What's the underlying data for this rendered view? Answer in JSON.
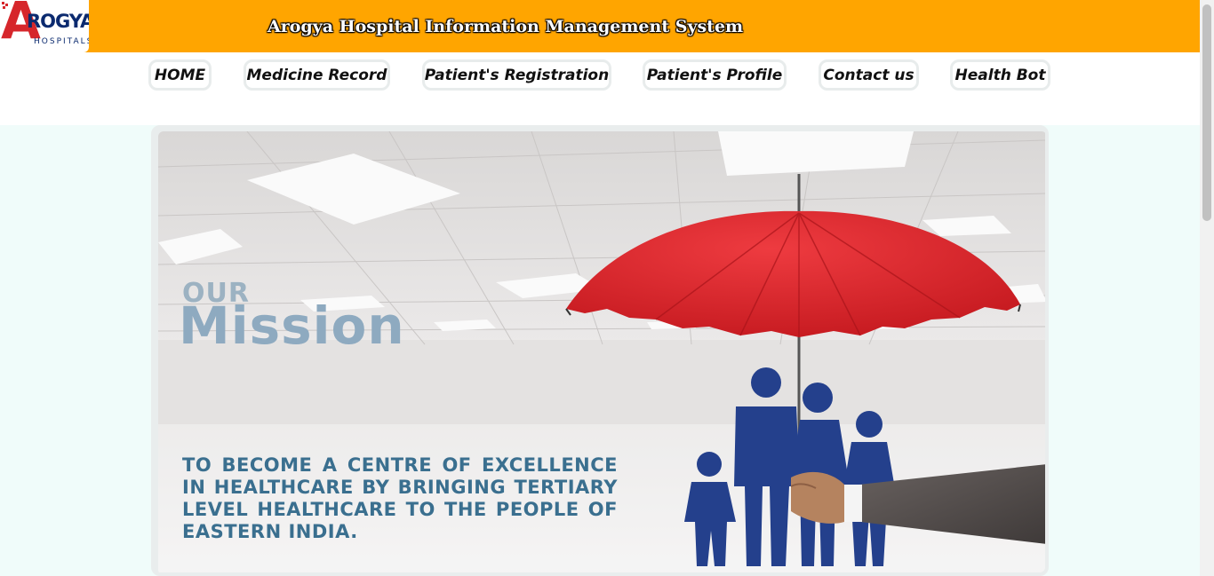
{
  "header": {
    "title": "Arogya Hospital Information Management System",
    "logo": {
      "letter": "A",
      "word": "ROGYA",
      "sub": "HOSPITALS"
    },
    "background_color": "#ffa500"
  },
  "nav": {
    "items": [
      {
        "label": "HOME"
      },
      {
        "label": "Medicine Record"
      },
      {
        "label": "Patient's Registration"
      },
      {
        "label": "Patient's Profile"
      },
      {
        "label": "Contact us"
      },
      {
        "label": "Health Bot"
      }
    ]
  },
  "hero": {
    "our": "OUR",
    "mission": "Mission",
    "statement": "TO BECOME A CENTRE OF EXCELLENCE IN HEALTHCARE BY BRINGING TERTIARY LEVEL HEALTHCARE TO THE PEOPLE OF EASTERN INDIA.",
    "icons": [
      "umbrella-icon",
      "family-icon",
      "hand-icon"
    ],
    "colors": {
      "umbrella": "#d9262c",
      "family": "#24408c",
      "text": "#3a6f8f"
    }
  }
}
